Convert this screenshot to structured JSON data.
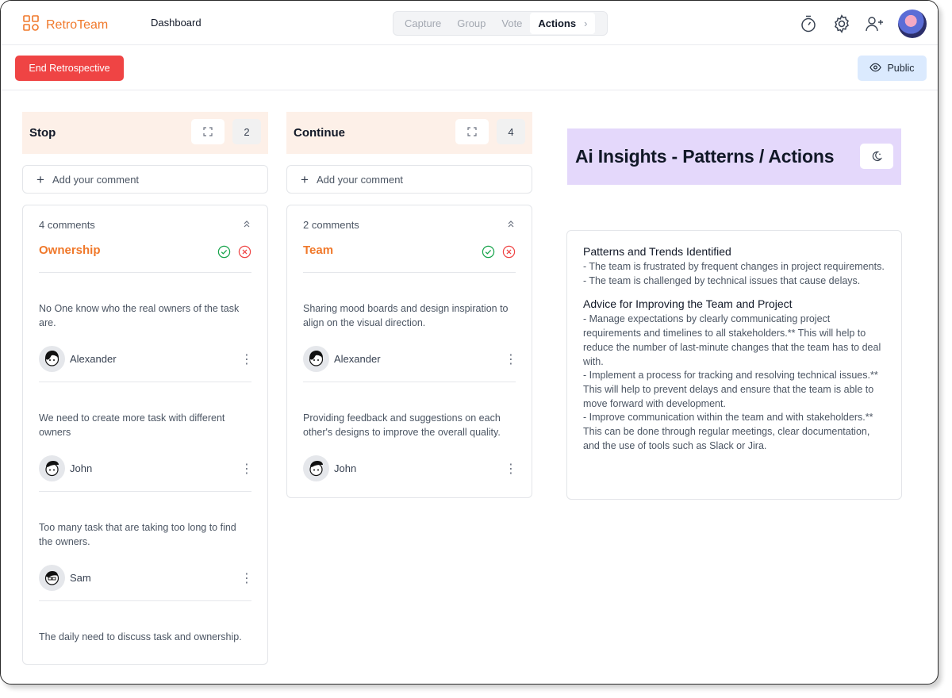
{
  "app": {
    "name": "RetroTeam",
    "nav_dashboard": "Dashboard"
  },
  "steps": [
    {
      "label": "Capture"
    },
    {
      "label": "Group"
    },
    {
      "label": "Vote"
    },
    {
      "label": "Actions",
      "active": true
    }
  ],
  "toolbar": {
    "end_label": "End Retrospective",
    "public_label": "Public"
  },
  "columns": {
    "stop": {
      "title": "Stop",
      "count": "2",
      "add_placeholder": "Add your comment",
      "comments_label": "4 comments",
      "group_title": "Ownership",
      "items": [
        {
          "text": "No One know who the real owners of the task are.",
          "author": "Alexander"
        },
        {
          "text": "We need to create more task with different owners",
          "author": "John"
        },
        {
          "text": "Too many task that are taking too long to find the owners.",
          "author": "Sam"
        },
        {
          "text": "The daily need to discuss task and ownership.",
          "author": ""
        }
      ]
    },
    "continue": {
      "title": "Continue",
      "count": "4",
      "add_placeholder": "Add your comment",
      "comments_label": "2 comments",
      "group_title": "Team",
      "items": [
        {
          "text": "Sharing mood boards and design inspiration to align on the visual direction.",
          "author": "Alexander"
        },
        {
          "text": "Providing feedback and suggestions on each other's designs to improve the overall quality.",
          "author": "John"
        }
      ]
    }
  },
  "ai": {
    "title": "Ai Insights - Patterns / Actions",
    "patterns_title": "Patterns and Trends Identified",
    "patterns": [
      "- The team is frustrated by frequent changes in project requirements.",
      "- The team is challenged by technical issues that cause delays."
    ],
    "advice_title": "Advice for Improving the Team and Project",
    "advice": [
      "- Manage expectations by clearly communicating project requirements and timelines to all stakeholders.** This will help to reduce the number of last-minute changes that the team has to deal with.",
      "- Implement a process for tracking and resolving technical issues.** This will help to prevent delays and ensure that the team is able to move forward with development.",
      "- Improve communication within the team and with stakeholders.** This can be done through regular meetings, clear documentation, and the use of tools such as Slack or Jira."
    ]
  },
  "colors": {
    "brand": "#f0782a",
    "danger": "#ef4444",
    "public_bg": "#dbeafe",
    "column_head_bg": "#fdf0e8",
    "ai_head_bg": "#e4d8fb"
  },
  "icons": [
    "logo-icon",
    "timer-icon",
    "gear-icon",
    "add-user-icon",
    "eye-icon",
    "expand-icon",
    "plus-icon",
    "chevron-up-icon",
    "check-circle-icon",
    "close-circle-icon",
    "more-vertical-icon",
    "moon-icon"
  ]
}
